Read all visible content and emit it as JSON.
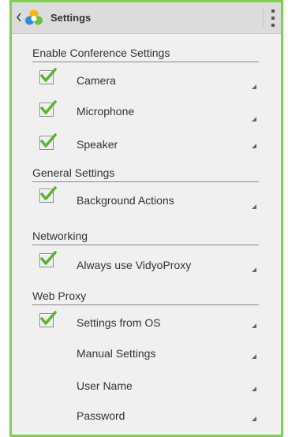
{
  "header": {
    "title": "Settings",
    "back_icon": "chevron-left-icon",
    "logo_icon": "vidyo-app-logo-icon",
    "overflow_icon": "overflow-menu-icon"
  },
  "colors": {
    "frame_border": "#7fd14a",
    "checkmark": "#5bb431",
    "background": "#f0f0f0",
    "action_bar": "#dcdcdc"
  },
  "sections": [
    {
      "title": "Enable Conference Settings",
      "items": [
        {
          "label": "Camera",
          "checked": true
        },
        {
          "label": "Microphone",
          "checked": true
        },
        {
          "label": "Speaker",
          "checked": true
        }
      ]
    },
    {
      "title": "General Settings",
      "items": [
        {
          "label": "Background Actions",
          "checked": true
        }
      ]
    },
    {
      "title": "Networking",
      "items": [
        {
          "label": "Always use VidyoProxy",
          "checked": true
        }
      ]
    },
    {
      "title": "Web Proxy",
      "items": [
        {
          "label": "Settings from OS",
          "checked": true
        },
        {
          "label": "Manual Settings",
          "checked": false
        },
        {
          "label": "User Name",
          "checked": false
        },
        {
          "label": "Password",
          "checked": false
        }
      ]
    }
  ]
}
